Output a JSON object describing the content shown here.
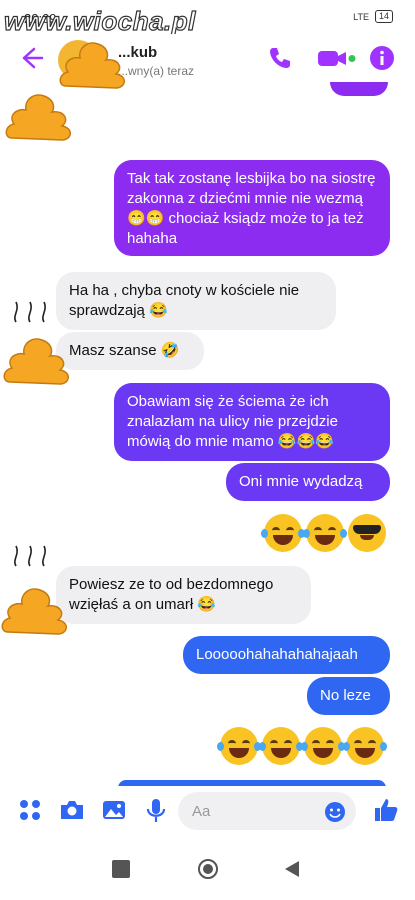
{
  "watermark": "www.wiocha.pl",
  "status": {
    "time": "20:09",
    "signal": "LTE",
    "battery": "14"
  },
  "header": {
    "name": "...kub",
    "active": "...wny(a) teraz"
  },
  "messages": [
    {
      "text": "Tak tak zostanę lesbijka bo na siostrę zakonna z dziećmi mnie nie wezmą 😁😁 chociaż ksiądz może to ja też hahaha"
    },
    {
      "text": "Ha ha , chyba cnoty w kościele nie sprawdzają 😂"
    },
    {
      "text": "Masz szanse 🤣"
    },
    {
      "text": "Obawiam się że ściema że ich znalazłam na ulicy nie przejdzie mówią do mnie mamo 😂😂😂"
    },
    {
      "text": "Oni mnie wydadzą"
    },
    {
      "text": "Powiesz ze to od bezdomnego wzięłaś a on umarł 😂"
    },
    {
      "text": "Looooohahahahahajaah"
    },
    {
      "text": "No leze"
    }
  ],
  "composer": {
    "placeholder": "Aa"
  },
  "colors": {
    "accent": "#8b2cf0",
    "blue": "#2f67f2",
    "messenger": "#a033ff"
  }
}
